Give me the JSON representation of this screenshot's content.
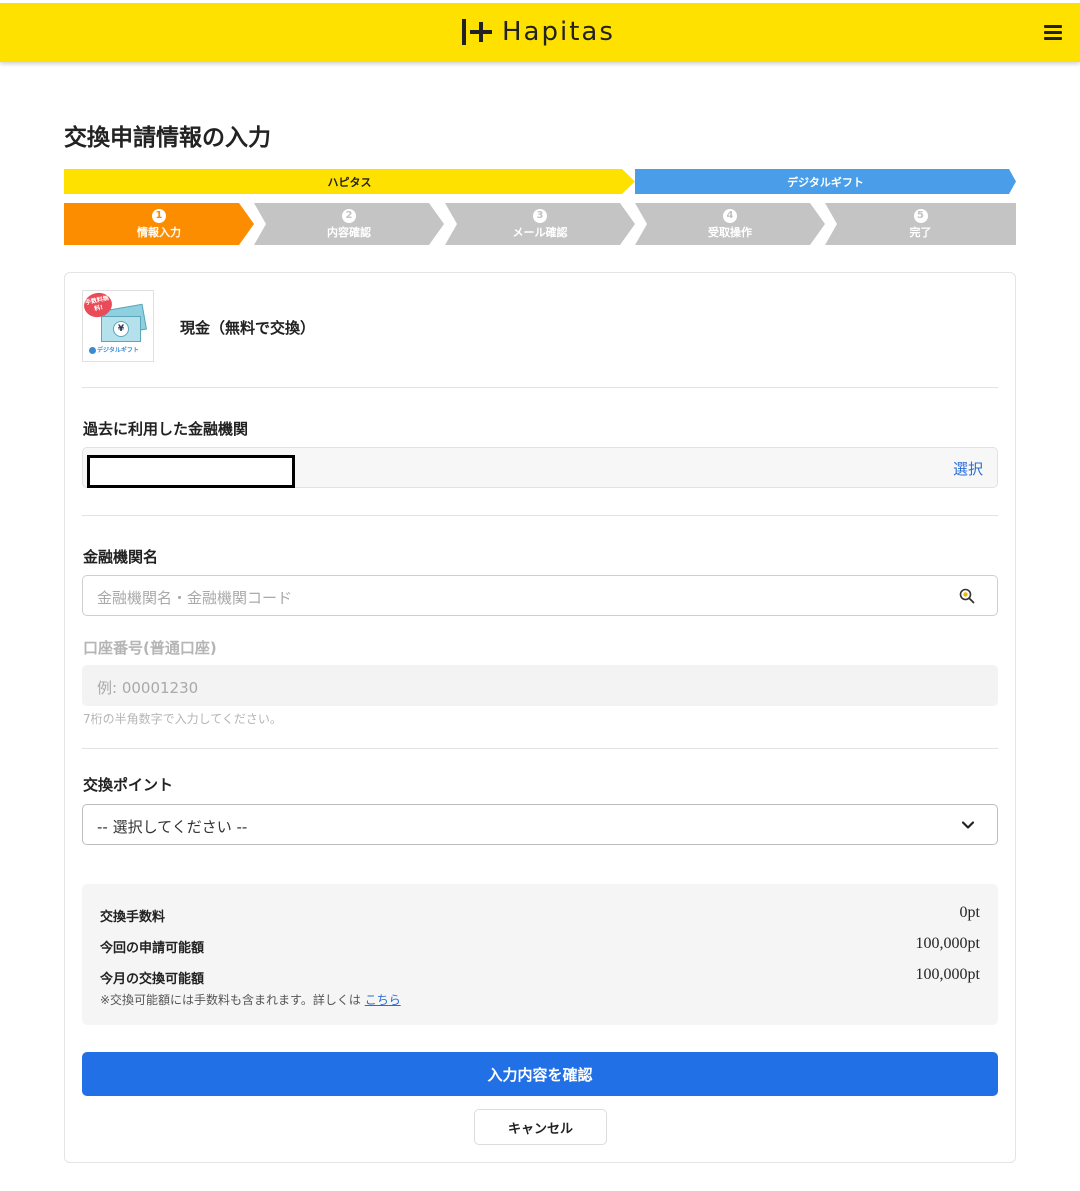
{
  "header": {
    "logo_text": "Hapitas",
    "brand_color": "#ffe100"
  },
  "page": {
    "title": "交換申請情報の入力"
  },
  "brands": {
    "hapitas": "ハピタス",
    "digital_gift": "デジタルギフト"
  },
  "steps": [
    {
      "num": "1",
      "label": "情報入力",
      "active": true
    },
    {
      "num": "2",
      "label": "内容確認",
      "active": false
    },
    {
      "num": "3",
      "label": "メール確認",
      "active": false
    },
    {
      "num": "4",
      "label": "受取操作",
      "active": false
    },
    {
      "num": "5",
      "label": "完了",
      "active": false
    }
  ],
  "item": {
    "title": "現金（無料で交換）",
    "thumb_badge": "手数料無料!",
    "thumb_caption": "デジタルギフト",
    "thumb_yen": "¥"
  },
  "previous_bank": {
    "label": "過去に利用した金融機関",
    "select_label": "選択"
  },
  "bank_name": {
    "label": "金融機関名",
    "placeholder": "金融機関名・金融機関コード"
  },
  "account": {
    "label": "口座番号(普通口座)",
    "placeholder": "例: 00001230",
    "hint": "7桁の半角数字で入力してください。"
  },
  "points": {
    "label": "交換ポイント",
    "selected": "-- 選択してください --"
  },
  "summary": {
    "rows": [
      {
        "key": "交換手数料",
        "value": "0pt"
      },
      {
        "key": "今回の申請可能額",
        "value": "100,000pt"
      },
      {
        "key": "今月の交換可能額",
        "value": "100,000pt"
      }
    ],
    "note": "※交換可能額には手数料も含まれます。詳しくは",
    "note_link": "こちら"
  },
  "actions": {
    "confirm": "入力内容を確認",
    "cancel": "キャンセル"
  },
  "colors": {
    "active_step": "#fd8d00",
    "inactive_step": "#c4c4c4",
    "digital_gift": "#4a9de8",
    "primary_button": "#2270e6",
    "link": "#2b6cd8"
  }
}
